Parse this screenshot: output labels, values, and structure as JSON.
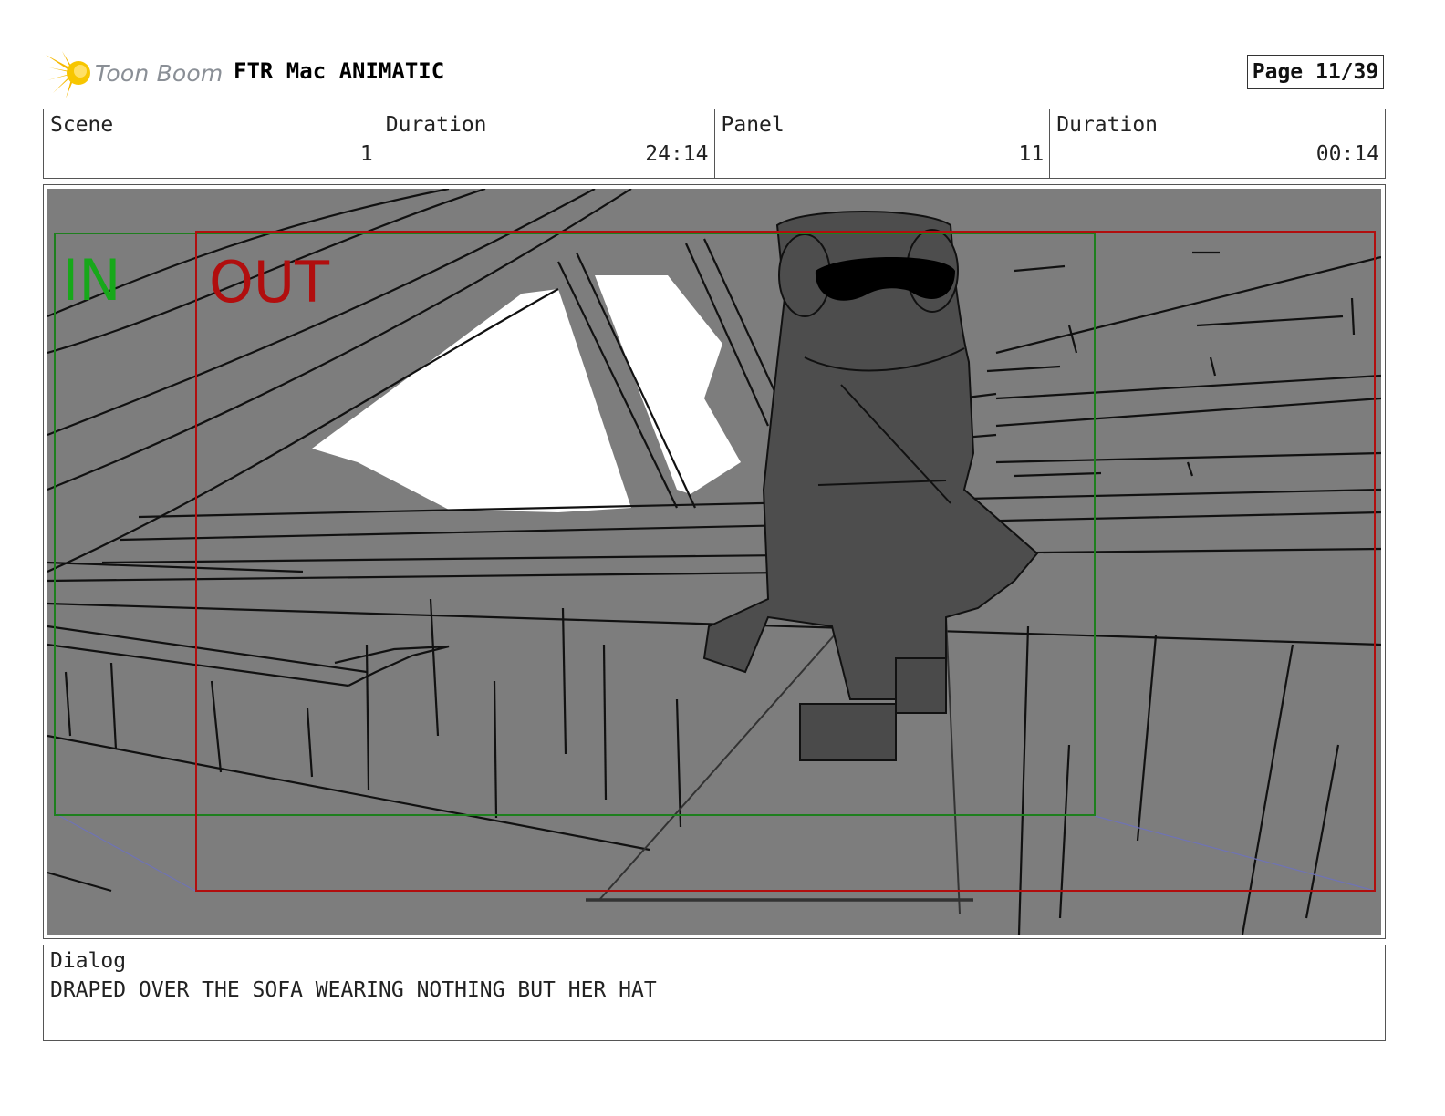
{
  "header": {
    "brand_name": "Toon Boom",
    "project_title": "FTR Mac ANIMATIC",
    "page_indicator": "Page 11/39"
  },
  "info": {
    "scene_label": "Scene",
    "scene_value": "1",
    "scene_duration_label": "Duration",
    "scene_duration_value": "24:14",
    "panel_label": "Panel",
    "panel_value": "11",
    "panel_duration_label": "Duration",
    "panel_duration_value": "00:14"
  },
  "panel": {
    "in_label": "IN",
    "out_label": "OUT",
    "in_frame_color": "#1e7f1e",
    "out_frame_color": "#b10e0e",
    "background_color": "#7d7d7d"
  },
  "dialog": {
    "label": "Dialog",
    "text": "DRAPED OVER THE SOFA WEARING NOTHING BUT HER HAT"
  }
}
